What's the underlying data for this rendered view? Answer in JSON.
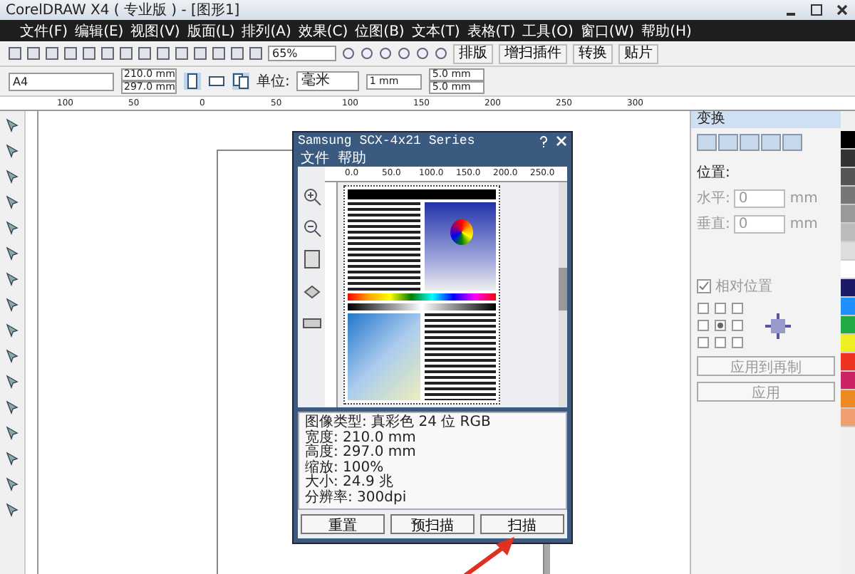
{
  "window": {
    "title": "CorelDRAW X4 ( 专业版 ) - [图形1]"
  },
  "menu": [
    "文件(F)",
    "编辑(E)",
    "视图(V)",
    "版面(L)",
    "排列(A)",
    "效果(C)",
    "位图(B)",
    "文本(T)",
    "表格(T)",
    "工具(O)",
    "窗口(W)",
    "帮助(H)"
  ],
  "toolbar": {
    "zoom": "65%",
    "buttons": [
      "排版",
      "增扫插件",
      "转换",
      "贴片"
    ]
  },
  "property_bar": {
    "paper": "A4",
    "width": "210.0 mm",
    "height": "297.0 mm",
    "unit_label": "单位:",
    "unit": "毫米",
    "nudge": "1 mm",
    "dup_x": "5.0 mm",
    "dup_y": "5.0 mm"
  },
  "ruler": [
    "100",
    "50",
    "0",
    "50",
    "100",
    "150",
    "200",
    "250",
    "300"
  ],
  "scanner_dialog": {
    "title": "Samsung SCX-4x21 Series",
    "menu": [
      "文件",
      "帮助"
    ],
    "preview_ruler": [
      "0.0",
      "50.0",
      "100.0",
      "150.0",
      "200.0",
      "250.0"
    ],
    "info": [
      "图像类型: 真彩色 24 位 RGB",
      "宽度: 210.0 mm",
      "高度: 297.0 mm",
      "缩放: 100%",
      "大小: 24.9 兆",
      "分辨率: 300dpi"
    ],
    "buttons": [
      "重置",
      "预扫描",
      "扫描"
    ]
  },
  "transform_panel": {
    "title": "变换",
    "position_label": "位置:",
    "fields": [
      {
        "label": "水平:",
        "value": "0",
        "unit": "mm"
      },
      {
        "label": "垂直:",
        "value": "0",
        "unit": "mm"
      }
    ],
    "relative": {
      "label": "相对位置",
      "checked": true
    },
    "buttons": [
      "应用到再制",
      "应用"
    ]
  },
  "palette": [
    {
      "color": "#000000"
    },
    {
      "color": "#333333"
    },
    {
      "color": "#555555"
    },
    {
      "color": "#777777"
    },
    {
      "color": "#999999"
    },
    {
      "color": "#bbbbbb"
    },
    {
      "color": "#dddddd"
    },
    {
      "color": "#ffffff"
    },
    {
      "color": "#1a1a66"
    },
    {
      "color": "#1e90ff"
    },
    {
      "color": "#22aa44"
    },
    {
      "color": "#eeee22"
    },
    {
      "color": "#ee3322"
    },
    {
      "color": "#cc2266"
    },
    {
      "color": "#ee8822"
    },
    {
      "color": "#f0a070"
    }
  ]
}
